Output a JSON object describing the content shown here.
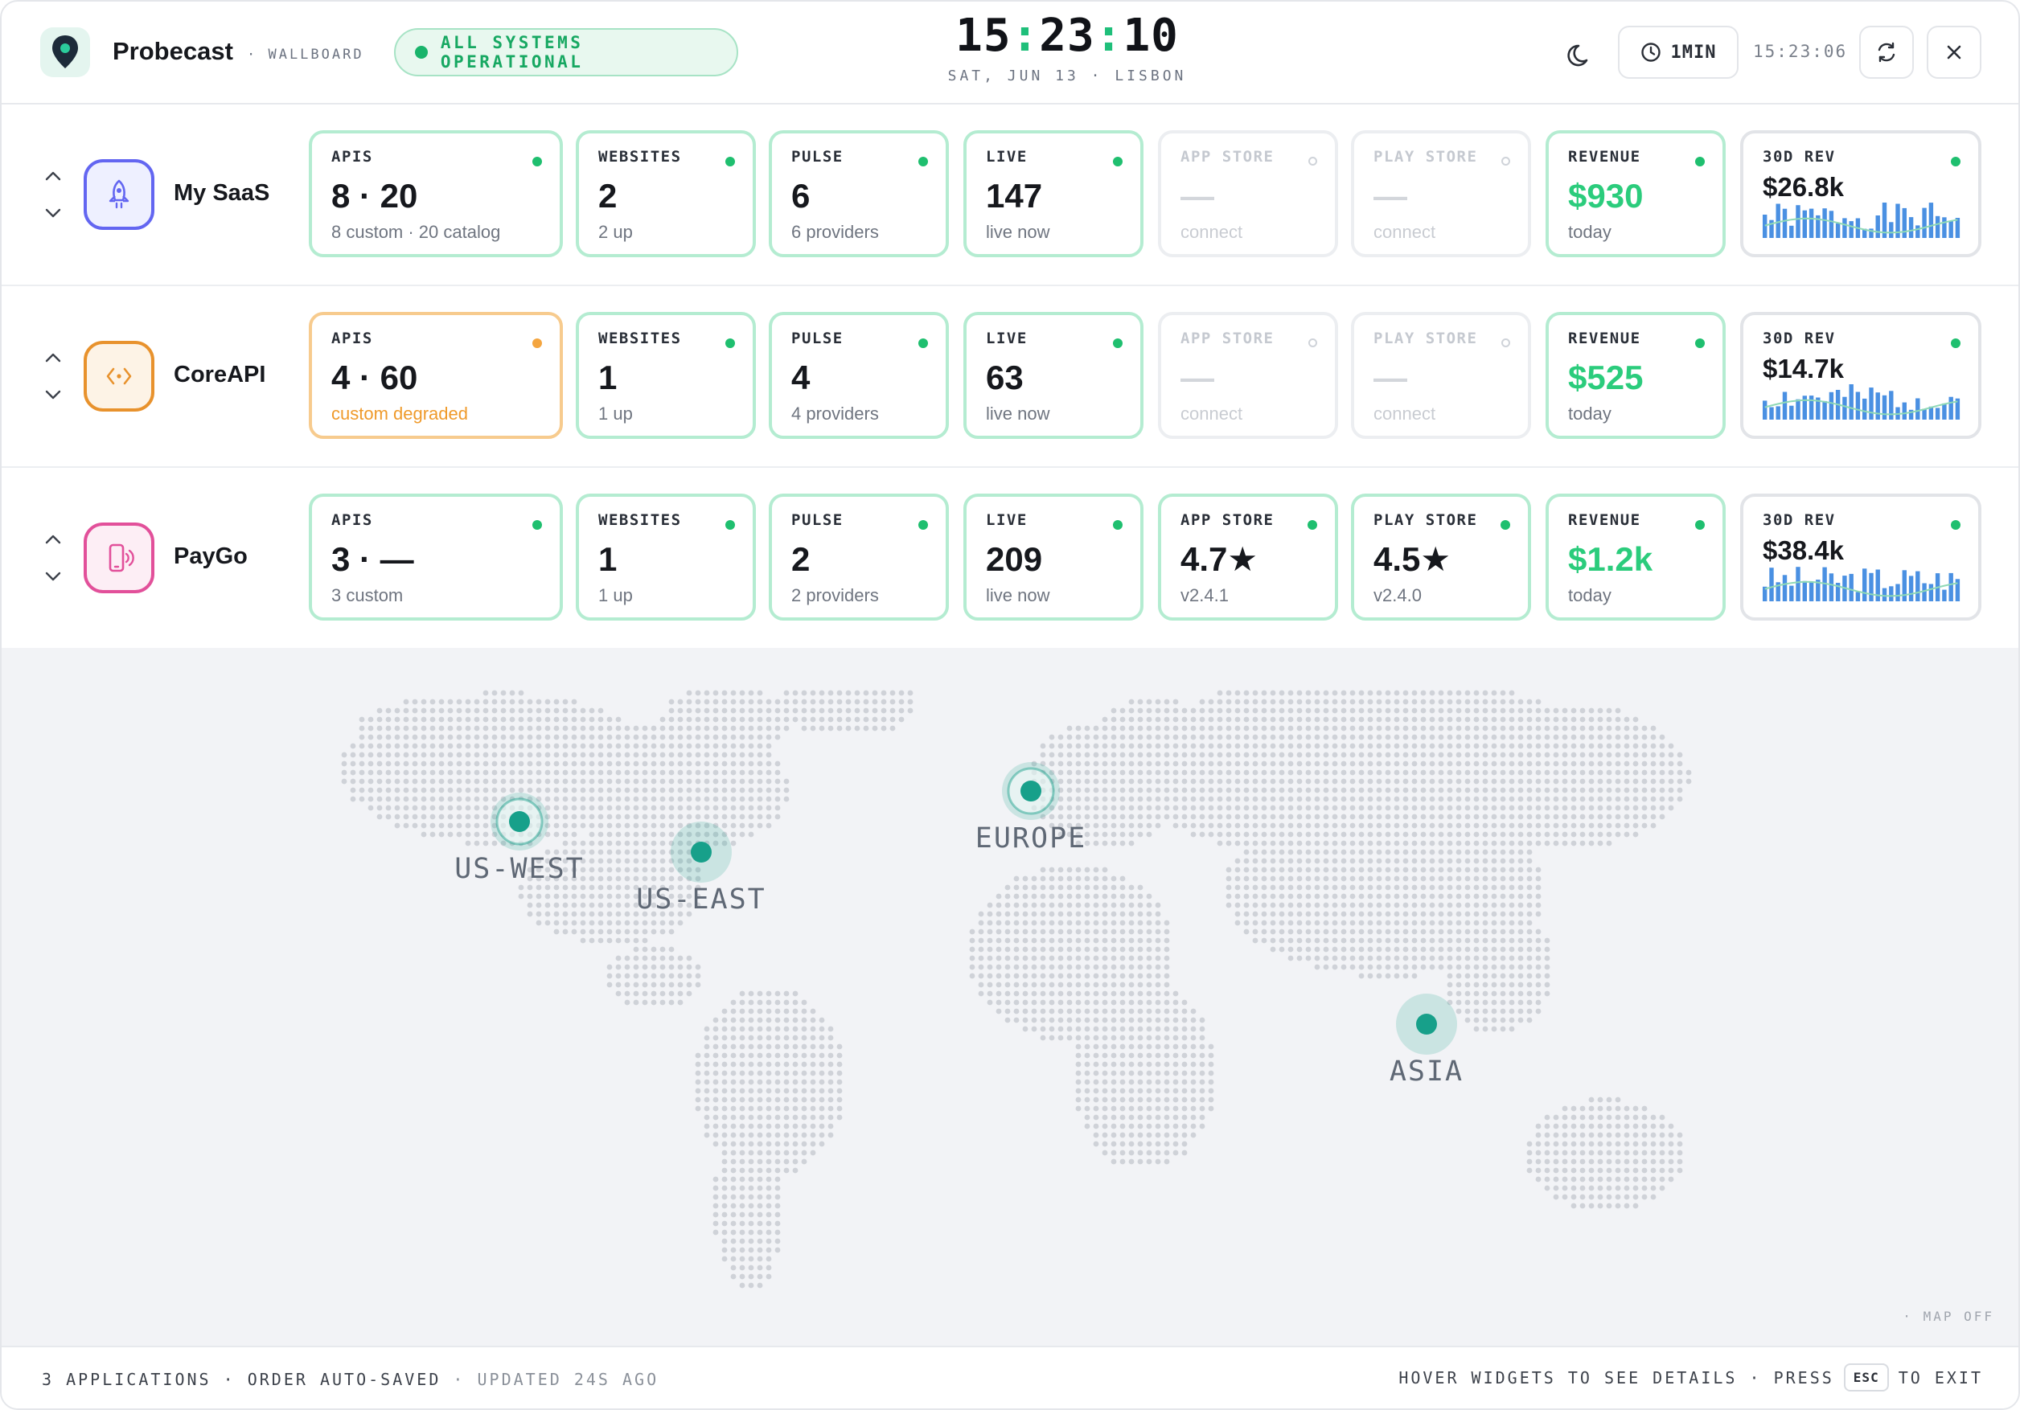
{
  "header": {
    "brand": "Probecast",
    "brand_sub": "· WALLBOARD",
    "status": "ALL SYSTEMS OPERATIONAL",
    "clock": {
      "h": "15",
      "m": "23",
      "s": "10"
    },
    "clock_sub": "SAT, JUN 13 · LISBON",
    "interval": "1MIN",
    "updated_time": "15:23:06",
    "icons": {
      "logo": "map-pin-icon",
      "theme": "moon-icon",
      "interval": "clock-icon",
      "refresh": "refresh-icon",
      "close": "close-icon"
    }
  },
  "colors": {
    "ok": "#1fbf6f",
    "warn": "#f4a53f",
    "accent_green": "#2bcc7c",
    "map_pin": "#17a08a",
    "bar_blue": "#4a90e2"
  },
  "apps": [
    {
      "name": "My SaaS",
      "icon": "rocket-icon",
      "icon_color": "#6366f1",
      "apis": {
        "label": "APIS",
        "value": "8 · 20",
        "sub": "8 custom · 20 catalog"
      },
      "websites": {
        "label": "WEBSITES",
        "value": "2",
        "sub": "2 up"
      },
      "pulse": {
        "label": "PULSE",
        "value": "6",
        "sub": "6 providers"
      },
      "live": {
        "label": "LIVE",
        "value": "147",
        "sub": "live now"
      },
      "app_store": {
        "label": "APP STORE",
        "value": "—",
        "sub": "connect"
      },
      "play_store": {
        "label": "PLAY STORE",
        "value": "—",
        "sub": "connect"
      },
      "revenue": {
        "label": "REVENUE",
        "value": "$930",
        "sub": "today"
      },
      "rev30": {
        "label": "30D REV",
        "value": "$26.8k"
      }
    },
    {
      "name": "CoreAPI",
      "icon": "code-icon",
      "icon_color": "#e8922d",
      "apis": {
        "label": "APIS",
        "value": "4 · 60",
        "sub": "custom degraded"
      },
      "websites": {
        "label": "WEBSITES",
        "value": "1",
        "sub": "1 up"
      },
      "pulse": {
        "label": "PULSE",
        "value": "4",
        "sub": "4 providers"
      },
      "live": {
        "label": "LIVE",
        "value": "63",
        "sub": "live now"
      },
      "app_store": {
        "label": "APP STORE",
        "value": "—",
        "sub": "connect"
      },
      "play_store": {
        "label": "PLAY STORE",
        "value": "—",
        "sub": "connect"
      },
      "revenue": {
        "label": "REVENUE",
        "value": "$525",
        "sub": "today"
      },
      "rev30": {
        "label": "30D REV",
        "value": "$14.7k"
      }
    },
    {
      "name": "PayGo",
      "icon": "phone-signal-icon",
      "icon_color": "#e2509a",
      "apis": {
        "label": "APIS",
        "value": "3 · —",
        "sub": "3 custom"
      },
      "websites": {
        "label": "WEBSITES",
        "value": "1",
        "sub": "1 up"
      },
      "pulse": {
        "label": "PULSE",
        "value": "2",
        "sub": "2 providers"
      },
      "live": {
        "label": "LIVE",
        "value": "209",
        "sub": "live now"
      },
      "app_store": {
        "label": "APP STORE",
        "value": "4.7★",
        "sub": "v2.4.1"
      },
      "play_store": {
        "label": "PLAY STORE",
        "value": "4.5★",
        "sub": "v2.4.0"
      },
      "revenue": {
        "label": "REVENUE",
        "value": "$1.2k",
        "sub": "today"
      },
      "rev30": {
        "label": "30D REV",
        "value": "$38.4k"
      }
    }
  ],
  "regions": {
    "us_west": "US-WEST",
    "us_east": "US-EAST",
    "europe": "EUROPE",
    "asia": "ASIA"
  },
  "map_off": "· MAP OFF",
  "footer": {
    "left_main": "3 APPLICATIONS · ORDER AUTO-SAVED",
    "left_muted": "· UPDATED 24S AGO",
    "right_pre": "HOVER WIDGETS TO SEE DETAILS · PRESS",
    "key": "ESC",
    "right_post": "TO EXIT"
  }
}
